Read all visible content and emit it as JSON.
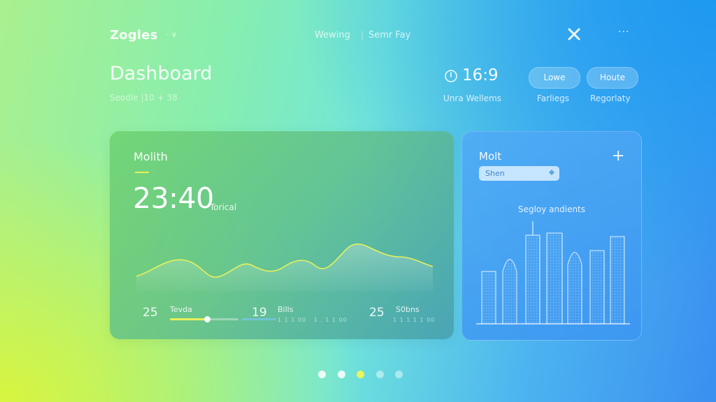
{
  "app": {
    "brand": "Zogles",
    "brand_caret": "· ∨"
  },
  "nav": {
    "links": [
      "Wewing",
      "Semr Fay"
    ],
    "separator": "|"
  },
  "window": {
    "close_icon": "close-icon",
    "more_label": "···"
  },
  "header": {
    "title": "Dashboard",
    "subtitle": "Seodle  |10 + 38",
    "clock": {
      "value": "16:9",
      "label": "Unra Wellems",
      "icon": "clock-icon"
    },
    "pills": [
      {
        "label": "Lowe",
        "sub": "Farliegs"
      },
      {
        "label": "Houte",
        "sub": "Regorlaty"
      }
    ]
  },
  "main_card": {
    "title": "Molith",
    "time": "23:40",
    "time_label": "Torical",
    "stats": [
      {
        "value": "25",
        "label": "Tevda",
        "progress": 0.54
      },
      {
        "value": "19",
        "label": "Bills",
        "ticks": "1 1 1 00 . 1 . 1 1 00"
      },
      {
        "value": "25",
        "label": "S0bns",
        "ticks": "1 1 1 1 1 00"
      }
    ],
    "accent_color": "#e4f25a"
  },
  "side_card": {
    "title": "Molt",
    "add_label": "+",
    "chip": "Shen",
    "label": "Segloy andients"
  },
  "pager": {
    "count": 5,
    "active_index": 2,
    "colors": {
      "active": "#e9f55a",
      "inactive": "rgba(255,255,255,0.85)"
    }
  }
}
